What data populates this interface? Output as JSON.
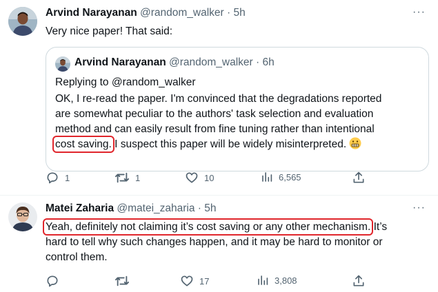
{
  "tweet1": {
    "name": "Arvind Narayanan",
    "handle": "@random_walker",
    "dot": "·",
    "time": "5h",
    "more": "···",
    "text": "Very nice paper! That said:",
    "quote": {
      "name": "Arvind Narayanan",
      "handle": "@random_walker",
      "dot": "·",
      "time": "6h",
      "replying_to": "Replying to @random_walker",
      "line1": "OK, I re-read the paper. I'm convinced that the degradations reported",
      "line2": "are somewhat peculiar to the authors' task selection and evaluation",
      "line3": "method and can easily result from fine tuning rather than intentional",
      "highlight": "cost saving.",
      "line4_rest": " I suspect this paper will be widely misinterpreted.",
      "emoji": "grimacing-face"
    },
    "actions": {
      "replies": "1",
      "retweets": "1",
      "likes": "10",
      "views": "6,565"
    }
  },
  "tweet2": {
    "name": "Matei Zaharia",
    "handle": "@matei_zaharia",
    "dot": "·",
    "time": "5h",
    "more": "···",
    "highlight": "Yeah, definitely not claiming it’s cost saving or any other mechanism.",
    "line1_rest": " It’s",
    "line2": "hard to tell why such changes happen, and it may be hard to monitor or",
    "line3": "control them.",
    "actions": {
      "replies": "",
      "retweets": "",
      "likes": "17",
      "views": "3,808"
    }
  },
  "colors": {
    "highlight_box": "#e0252b",
    "muted": "#536471",
    "border": "#cfd9de"
  }
}
